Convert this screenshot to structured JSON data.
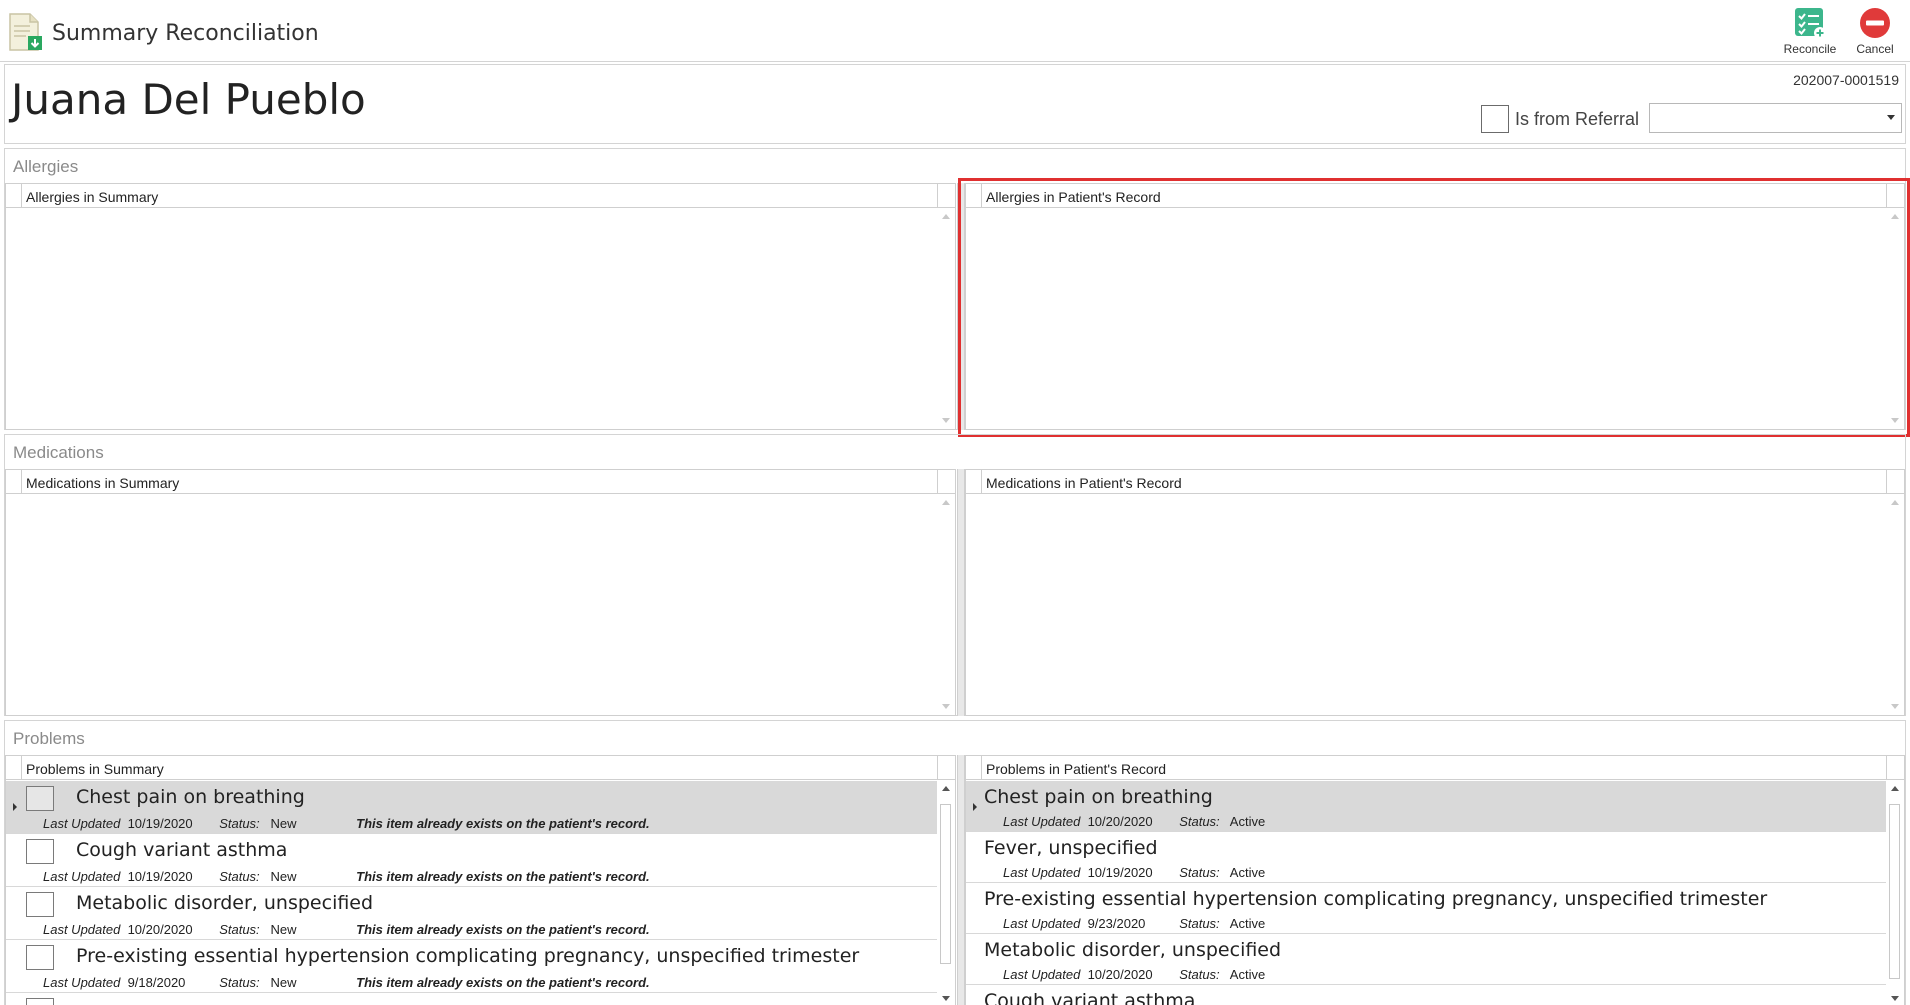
{
  "window": {
    "title": "Summary Reconciliation"
  },
  "toolbar": {
    "reconcile_label": "Reconcile",
    "cancel_label": "Cancel"
  },
  "patient": {
    "name": "Juana Del Pueblo",
    "record_number": "202007-0001519"
  },
  "referral": {
    "label": "Is from Referral",
    "checked": false,
    "selected": ""
  },
  "allergies": {
    "title": "Allergies",
    "summary_header": "Allergies in Summary",
    "record_header": "Allergies in Patient's Record"
  },
  "medications": {
    "title": "Medications",
    "summary_header": "Medications in Summary",
    "record_header": "Medications in Patient's Record"
  },
  "problems": {
    "title": "Problems",
    "summary_header": "Problems in Summary",
    "record_header": "Problems in Patient's Record",
    "last_updated_label": "Last Updated",
    "status_label": "Status:",
    "summary_items": [
      {
        "name": "Chest pain on breathing",
        "date": "10/19/2020",
        "status": "New",
        "note": "This item already exists on the patient's record."
      },
      {
        "name": "Cough variant asthma",
        "date": "10/19/2020",
        "status": "New",
        "note": "This item already exists on the patient's record."
      },
      {
        "name": "Metabolic disorder, unspecified",
        "date": "10/20/2020",
        "status": "New",
        "note": "This item already exists on the patient's record."
      },
      {
        "name": "Pre-existing essential hypertension complicating pregnancy, unspecified trimester",
        "date": "9/18/2020",
        "status": "New",
        "note": "This item already exists on the patient's record."
      }
    ],
    "record_items": [
      {
        "name": "Chest pain on breathing",
        "date": "10/20/2020",
        "status": "Active"
      },
      {
        "name": "Fever, unspecified",
        "date": "10/19/2020",
        "status": "Active"
      },
      {
        "name": "Pre-existing essential hypertension complicating pregnancy, unspecified trimester",
        "date": "9/23/2020",
        "status": "Active"
      },
      {
        "name": "Metabolic disorder, unspecified",
        "date": "10/20/2020",
        "status": "Active"
      },
      {
        "name": "Cough variant asthma",
        "date": "",
        "status": ""
      }
    ]
  },
  "colors": {
    "highlight": "#e03030",
    "reconcile_icon": "#3cb68c",
    "cancel_icon": "#e03a3a"
  }
}
